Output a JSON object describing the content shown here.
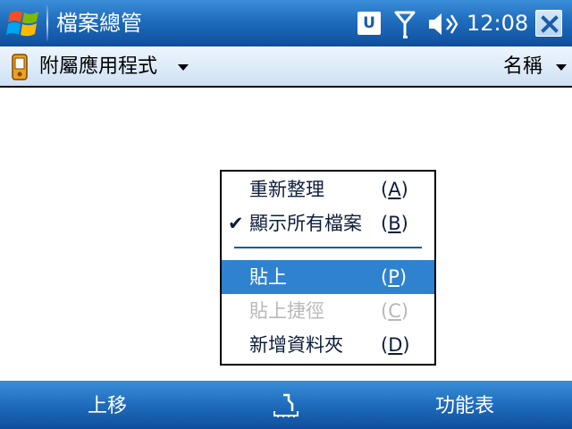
{
  "titlebar": {
    "app_title": "檔案總管",
    "connectivity_badge": "U",
    "clock": "12:08"
  },
  "folderbar": {
    "folder_label": "附屬應用程式",
    "sort_label": "名稱"
  },
  "context_menu": {
    "items": [
      {
        "label": "重新整理",
        "accel_open": "(",
        "accel_key": "A",
        "accel_close": ")",
        "checked": false,
        "highlighted": false,
        "disabled": false
      },
      {
        "label": "顯示所有檔案",
        "accel_open": "(",
        "accel_key": "B",
        "accel_close": ")",
        "checked": true,
        "highlighted": false,
        "disabled": false
      },
      {
        "label": "貼上",
        "accel_open": "(",
        "accel_key": "P",
        "accel_close": ")",
        "checked": false,
        "highlighted": true,
        "disabled": false
      },
      {
        "label": "貼上捷徑",
        "accel_open": "(",
        "accel_key": "C",
        "accel_close": ")",
        "checked": false,
        "highlighted": false,
        "disabled": true
      },
      {
        "label": "新增資料夾",
        "accel_open": "(",
        "accel_key": "D",
        "accel_close": ")",
        "checked": false,
        "highlighted": false,
        "disabled": false
      }
    ],
    "check_mark": "✔"
  },
  "softkeys": {
    "left_label": "上移",
    "right_label": "功能表"
  },
  "icons": {
    "start": "windows-flag-icon",
    "signal": "antenna-signal-icon",
    "volume": "speaker-icon",
    "close": "close-icon",
    "folder": "pda-device-icon",
    "sip": "input-panel-icon"
  },
  "colors": {
    "titlebar_top": "#3a8ed8",
    "titlebar_bottom": "#0f4f9c",
    "menu_highlight": "#2f82cf",
    "disabled_text": "#b8b8b8"
  }
}
